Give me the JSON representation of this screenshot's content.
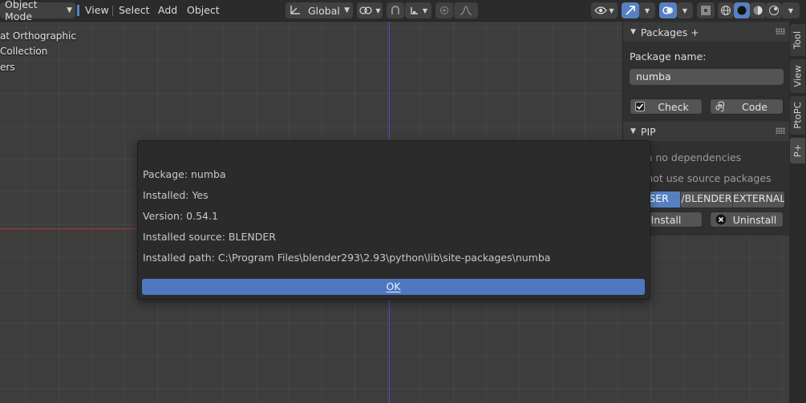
{
  "header": {
    "mode_label": "Object Mode",
    "menu": [
      "View",
      "Select",
      "Add",
      "Object"
    ],
    "transform_orientation": "Global"
  },
  "overlay": {
    "lines": [
      "at Orthographic",
      "Collection",
      "ers"
    ]
  },
  "npanel": {
    "packages_title": "Packages +",
    "package_name_label": "Package name:",
    "package_name_value": "numba",
    "check_label": "Check",
    "code_label": "Code",
    "pip_title": "PIP",
    "option1": "With no dependencies",
    "option2": "Do not use source packages",
    "targets": [
      "USER",
      "/BLENDER",
      "EXTERNAL"
    ],
    "selected_target": "USER",
    "install_label": "Install",
    "uninstall_label": "Uninstall"
  },
  "sidebar_tabs": [
    "Tool",
    "View",
    "PtoPC",
    "P+"
  ],
  "dialog": {
    "package_line": "Package: numba",
    "installed_line": "Installed: Yes",
    "version_line": "Version: 0.54.1",
    "source_line": "Installed source: BLENDER",
    "path_line": "Installed path: C:\\Program Files\\blender293\\2.93\\python\\lib\\site-packages\\numba",
    "ok_label": "OK"
  },
  "colors": {
    "accent": "#5680c2",
    "ok_button": "#4d78c0",
    "z_axis": "#4a4ac8",
    "x_axis": "#a83838"
  }
}
